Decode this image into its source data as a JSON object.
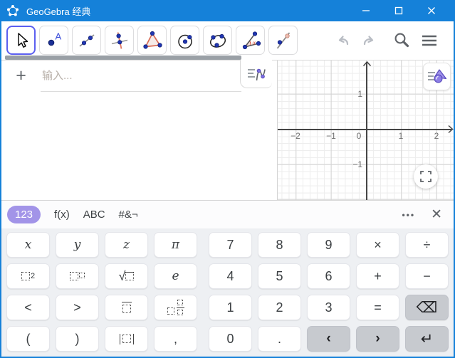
{
  "colors": {
    "titlebar_blue": "#1581d9",
    "selected_tool": "#5b5ff0",
    "tab_pill": "#a294e8",
    "gray_key": "#c7cacf",
    "point_blue": "#2036b1",
    "shape_red": "#d96c55",
    "icon_purple": "#8d7ee6"
  },
  "window": {
    "title": "GeoGebra 经典",
    "controls": [
      {
        "name": "minimize",
        "icon": "minimize-icon"
      },
      {
        "name": "maximize",
        "icon": "maximize-icon"
      },
      {
        "name": "close",
        "icon": "close-icon"
      }
    ]
  },
  "toolbar": {
    "tools": [
      {
        "name": "move",
        "icon": "cursor-icon",
        "selected": true
      },
      {
        "name": "point",
        "icon": "point-icon"
      },
      {
        "name": "line",
        "icon": "line-icon"
      },
      {
        "name": "perpendicular-line",
        "icon": "perpendicular-line-icon"
      },
      {
        "name": "polygon",
        "icon": "polygon-icon"
      },
      {
        "name": "circle",
        "icon": "circle-icon"
      },
      {
        "name": "ellipse",
        "icon": "ellipse-icon"
      },
      {
        "name": "angle",
        "icon": "angle-icon"
      },
      {
        "name": "reflect-about-line",
        "icon": "reflect-icon"
      }
    ],
    "actions": [
      {
        "name": "undo",
        "icon": "undo-icon",
        "enabled": false
      },
      {
        "name": "redo",
        "icon": "redo-icon",
        "enabled": false
      },
      {
        "name": "search",
        "icon": "search-icon",
        "enabled": true
      },
      {
        "name": "menu",
        "icon": "hamburger-icon",
        "enabled": true
      }
    ]
  },
  "algebra": {
    "add_label": "+",
    "input_placeholder": "输入...",
    "toggle_icon": "function-list-icon"
  },
  "graphics": {
    "x_ticks": [
      {
        "label": "−2",
        "x": 25
      },
      {
        "label": "−1",
        "x": 75
      },
      {
        "label": "0",
        "x": 114
      },
      {
        "label": "1",
        "x": 173
      },
      {
        "label": "2",
        "x": 223
      }
    ],
    "y_ticks": [
      {
        "label": "1",
        "y": 47
      },
      {
        "label": "−1",
        "y": 146
      }
    ],
    "settings_icon": "styling-menu-icon",
    "fullscreen_icon": "fullscreen-icon"
  },
  "keyboard": {
    "tabs": [
      {
        "id": "123",
        "label": "123",
        "active": true
      },
      {
        "id": "fx",
        "label": "f(x)",
        "active": false
      },
      {
        "id": "abc",
        "label": "ABC",
        "active": false
      },
      {
        "id": "symbols",
        "label": "#&¬",
        "active": false
      }
    ],
    "more_label": "•••",
    "close_label": "✕",
    "rows": [
      [
        {
          "name": "x",
          "style": "it",
          "v": "x"
        },
        {
          "name": "y",
          "style": "it",
          "v": "y"
        },
        {
          "name": "z",
          "style": "it",
          "v": "z"
        },
        {
          "name": "pi",
          "style": "it",
          "v": "π"
        },
        {
          "name": "7",
          "v": "7"
        },
        {
          "name": "8",
          "v": "8"
        },
        {
          "name": "9",
          "v": "9"
        },
        {
          "name": "multiply",
          "v": "×"
        },
        {
          "name": "divide",
          "v": "÷"
        }
      ],
      [
        {
          "name": "x-squared",
          "icon": "square"
        },
        {
          "name": "power",
          "icon": "power"
        },
        {
          "name": "sqrt",
          "icon": "sqrt"
        },
        {
          "name": "e",
          "style": "it",
          "v": "e"
        },
        {
          "name": "4",
          "v": "4"
        },
        {
          "name": "5",
          "v": "5"
        },
        {
          "name": "6",
          "v": "6"
        },
        {
          "name": "plus",
          "v": "+"
        },
        {
          "name": "minus",
          "v": "−"
        }
      ],
      [
        {
          "name": "less-than",
          "v": "<"
        },
        {
          "name": "greater-than",
          "v": ">"
        },
        {
          "name": "fraction",
          "icon": "fraction"
        },
        {
          "name": "mixed-number",
          "icon": "mixed"
        },
        {
          "name": "1",
          "v": "1"
        },
        {
          "name": "2",
          "v": "2"
        },
        {
          "name": "3",
          "v": "3"
        },
        {
          "name": "equals",
          "v": "="
        },
        {
          "name": "backspace",
          "v": "⌫",
          "gray": true,
          "style": "big"
        }
      ],
      [
        {
          "name": "open-paren",
          "v": "("
        },
        {
          "name": "close-paren",
          "v": ")"
        },
        {
          "name": "abs",
          "icon": "abs"
        },
        {
          "name": "comma",
          "v": ","
        },
        {
          "name": "0",
          "v": "0"
        },
        {
          "name": "decimal-point",
          "v": "."
        },
        {
          "name": "cursor-left",
          "v": "‹",
          "gray": true,
          "style": "chev"
        },
        {
          "name": "cursor-right",
          "v": "›",
          "gray": true,
          "style": "chev"
        },
        {
          "name": "enter",
          "v": "↵",
          "gray": true,
          "style": "big"
        }
      ]
    ]
  }
}
